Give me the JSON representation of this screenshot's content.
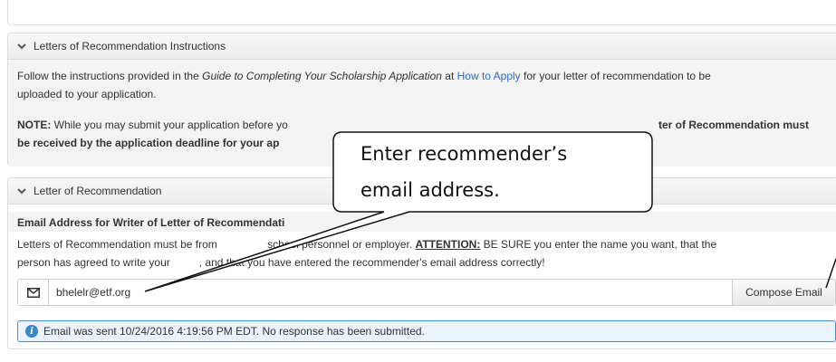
{
  "panels": {
    "instructions": {
      "title": "Letters of Recommendation Instructions",
      "p1_before": "Follow the instructions provided in the ",
      "p1_guide": "Guide to Completing Your Scholarship Application",
      "p1_at": " at ",
      "p1_link": "How to Apply",
      "p1_after": " for your letter of recommendation to be",
      "p1_line2": "uploaded to your application.",
      "note_label": "NOTE:",
      "note_text": " While you may submit your application before yo",
      "note_bold_right": "ter of Recommendation must",
      "note_line2": "be received by the application deadline for your ap"
    },
    "letter": {
      "title": "Letter of Recommendation",
      "email_label": "Email Address for Writer of Letter of Recommendati",
      "desc_line1_a": "Letters of Recommendation must be from ",
      "desc_line1_b": "school personnel or employer. ",
      "attention": "ATTENTION:",
      "desc_line1_c": " BE SURE you enter the name you want, that the",
      "desc_line2_a": "person has agreed to write your",
      "desc_line2_b": ", and that you have entered the recommender's email address correctly!",
      "email_value": "bhelelr@etf.org",
      "compose_label": "Compose Email",
      "alert_text": "Email was sent 10/24/2016 4:19:56 PM EDT. No response has been submitted."
    }
  },
  "callout": {
    "line1": "Enter recommender’s",
    "line2": "email address."
  },
  "icons": {
    "chevron": "chevron-down-icon",
    "envelope": "envelope-icon",
    "info": "info-icon"
  },
  "colors": {
    "link": "#2a6ebb",
    "alert_border": "#4a90d9",
    "info_icon": "#3a87c8"
  }
}
